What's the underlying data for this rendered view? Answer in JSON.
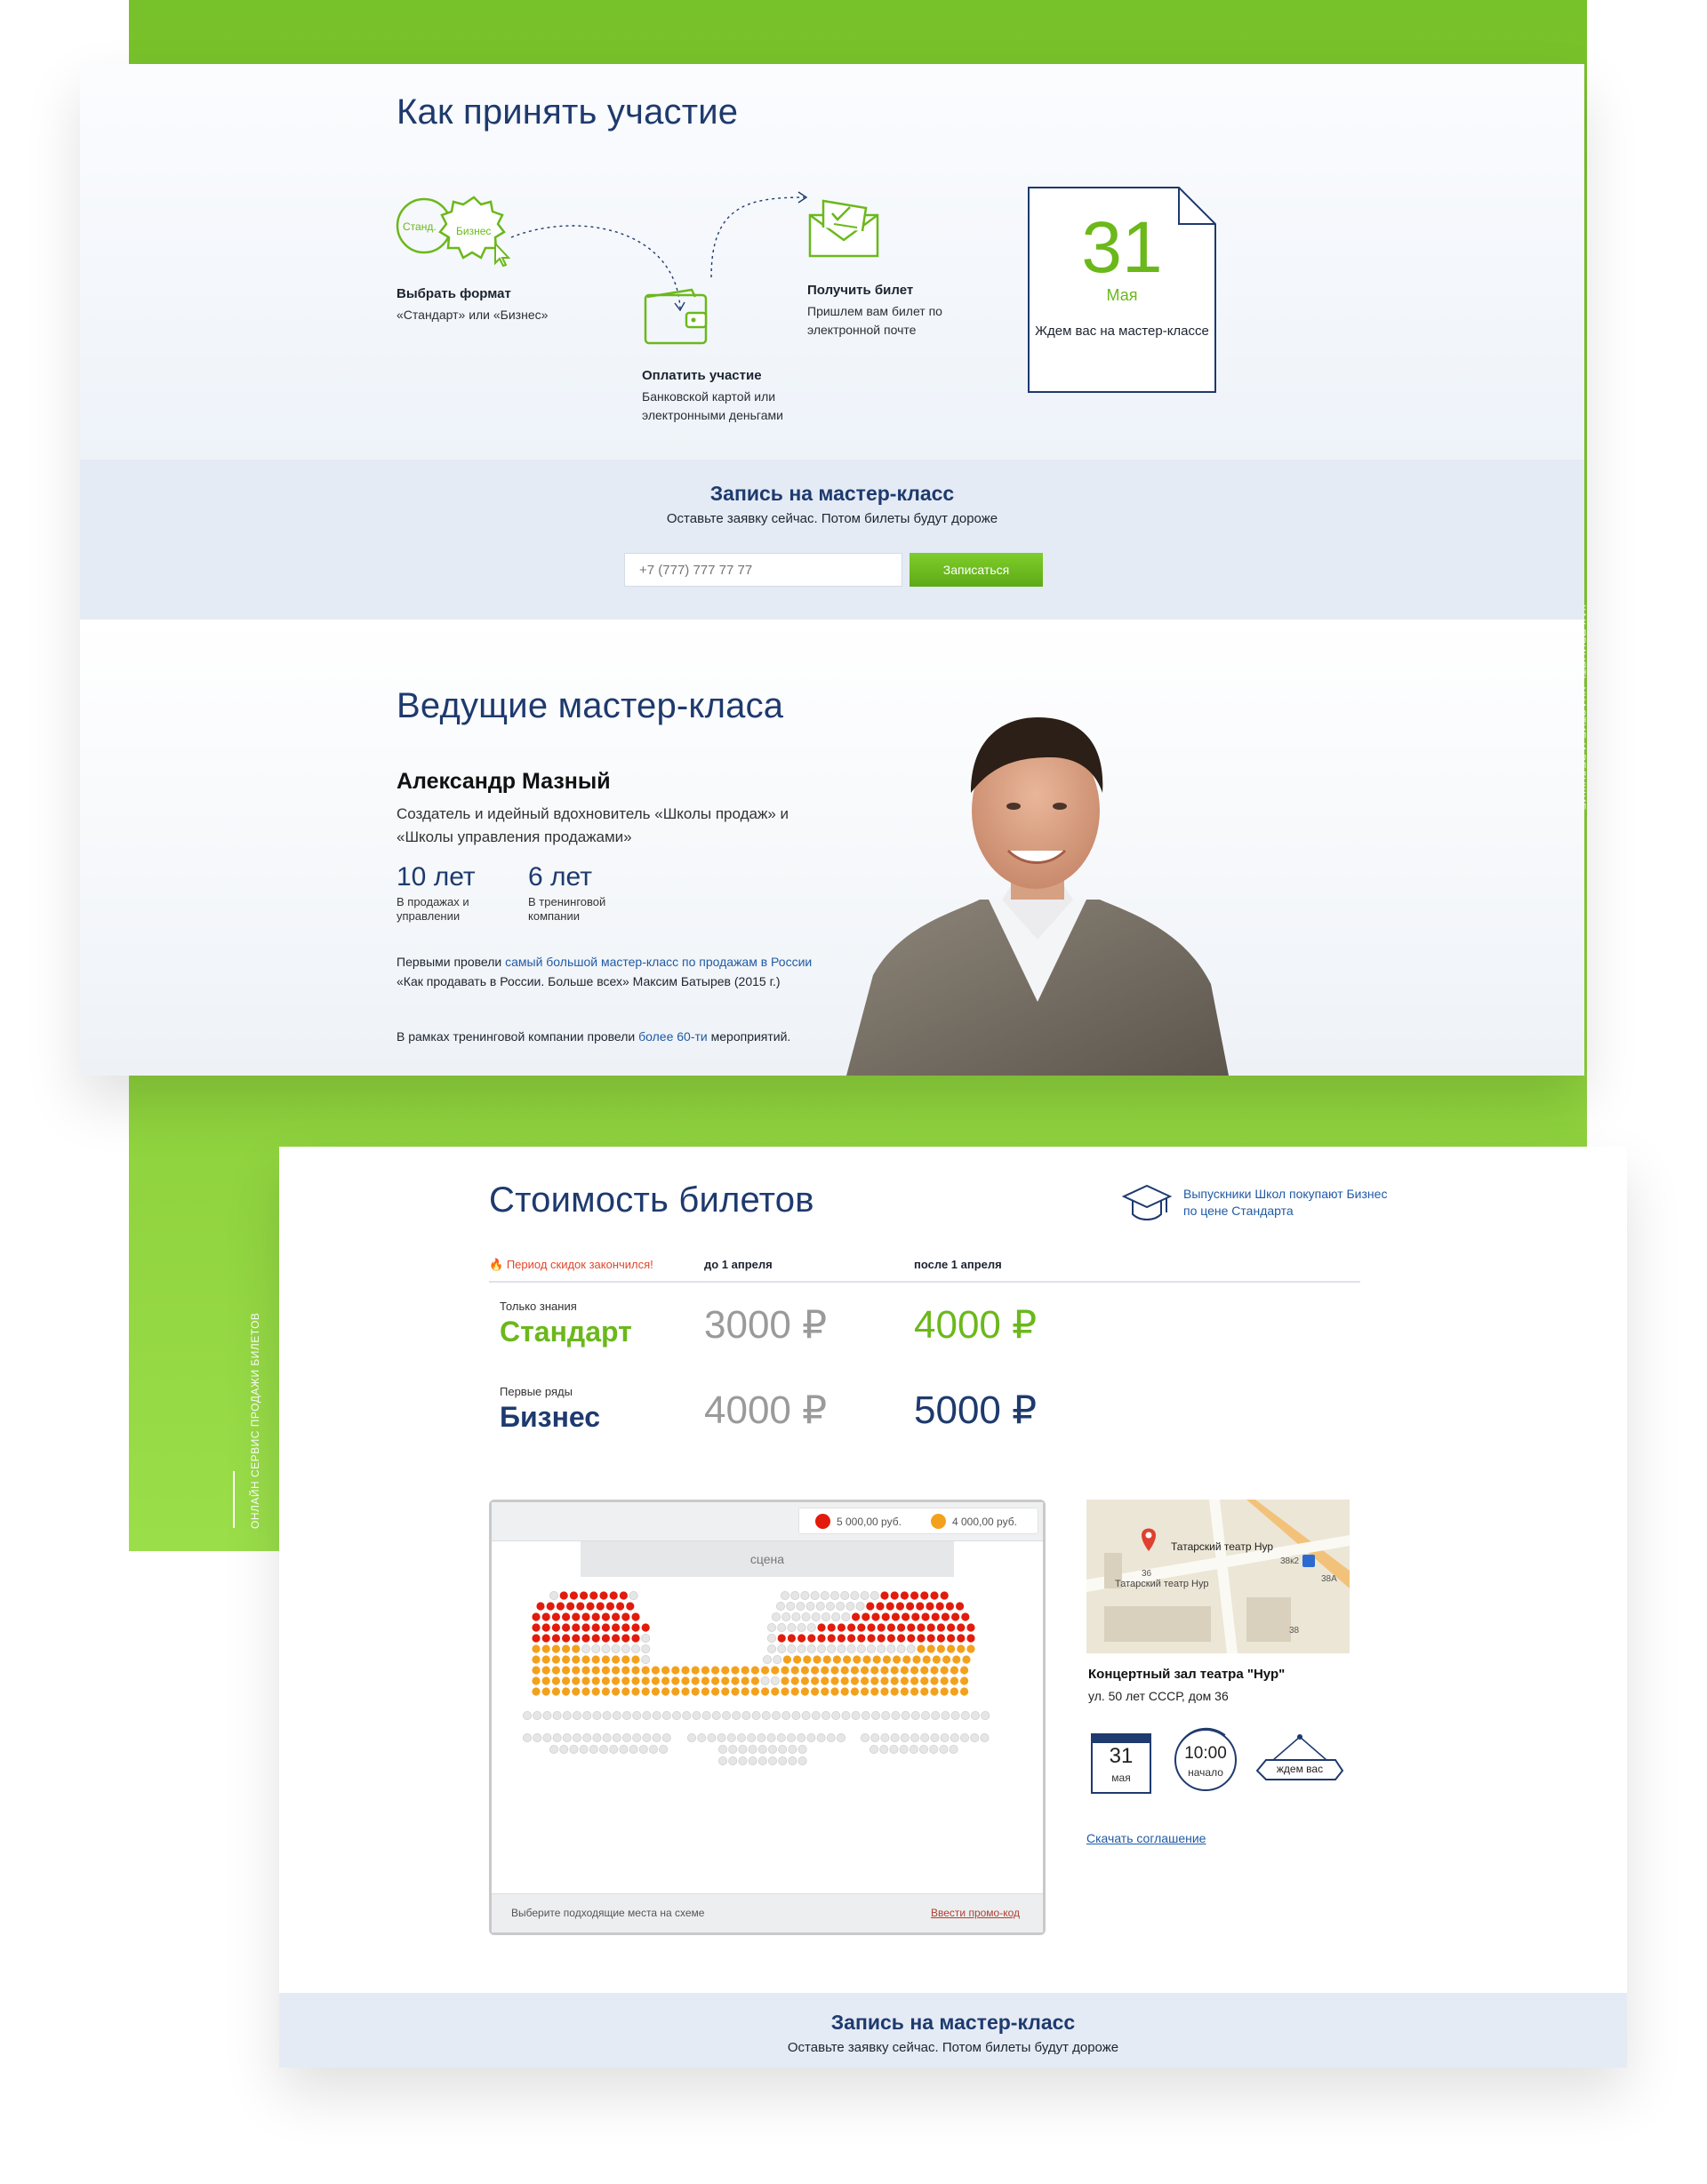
{
  "side": {
    "right_label": "КАК ПРИНЯТЬ УЧАСТИЕ И ВЕДУЩИЕ",
    "left_label": "ОНЛАЙН СЕРВИС ПРОДАЖИ БИЛЕТОВ"
  },
  "how": {
    "title": "Как принять участие",
    "format_badges": [
      "Станд.",
      "Бизнес"
    ],
    "steps": [
      {
        "title": "Выбрать формат",
        "desc": "«Стандарт» или «Бизнес»"
      },
      {
        "title": "Оплатить участие",
        "desc": "Банковской картой или электронными деньгами"
      },
      {
        "title": "Получить билет",
        "desc": "Пришлем вам билет по электронной почте"
      }
    ],
    "date_card": {
      "day": "31",
      "month": "Мая",
      "note": "Ждем вас на мастер-классе"
    }
  },
  "signup": {
    "title": "Запись на мастер-класс",
    "subtitle": "Оставьте заявку сейчас. Потом билеты будут дороже",
    "phone_placeholder": "+7 (777) 777 77 77",
    "button": "Записаться"
  },
  "leaders": {
    "title": "Ведущие мастер-класа",
    "name": "Александр Мазный",
    "role": "Создатель и идейный вдохновитель «Школы продаж» и «Школы управления продажами»",
    "stats": [
      {
        "value": "10 лет",
        "label": "В продажах и управлении"
      },
      {
        "value": "6 лет",
        "label": "В тренинговой компании"
      }
    ],
    "fact1": {
      "pre": "Первыми провели ",
      "link": "самый большой мастер-класс по продажам в России",
      "post": " «Как продавать в России. Больше всех» Максим Батырев (2015 г.)"
    },
    "fact2": {
      "pre": "В рамках тренинговой компании провели ",
      "link": "более 60-ти",
      "post": " мероприятий."
    }
  },
  "prices": {
    "title": "Стоимость билетов",
    "graduates_note": "Выпускники Школ покупают Бизнес по цене Стандарта",
    "expired": "Период скидок закончился!",
    "col_before": "до 1 апреля",
    "col_after": "после 1 апреля",
    "tiers": [
      {
        "sub": "Только знания",
        "name": "Стандарт",
        "before": "3000 ₽",
        "after": "4000 ₽"
      },
      {
        "sub": "Первые ряды",
        "name": "Бизнес",
        "before": "4000 ₽",
        "after": "5000 ₽"
      }
    ]
  },
  "hall": {
    "legend": [
      {
        "color": "#e21b0c",
        "label": "5 000,00 руб."
      },
      {
        "color": "#f3a11c",
        "label": "4 000,00 руб."
      }
    ],
    "stage": "сцена",
    "hint": "Выберите подходящие места на схеме",
    "promo": "Ввести промо-код"
  },
  "venue": {
    "map_label": "Татарский театр Нур",
    "map_label2": "Татарский театр Нур",
    "map_numbers": [
      "36",
      "38к2",
      "38А",
      "38"
    ],
    "name": "Концертный зал театра \"Нур\"",
    "address": "ул. 50 лет СССР, дом 36",
    "cal_day": "31",
    "cal_month": "мая",
    "time": "10:00",
    "time_label": "начало",
    "wait": "ждем вас",
    "agreement": "Скачать соглашение"
  },
  "colors": {
    "green": "#6bb81b",
    "navy": "#1e3a6e",
    "link": "#1f5aa5",
    "seat_red": "#e21b0c",
    "seat_orange": "#f3a11c",
    "seat_free": "#e6e6e6"
  }
}
